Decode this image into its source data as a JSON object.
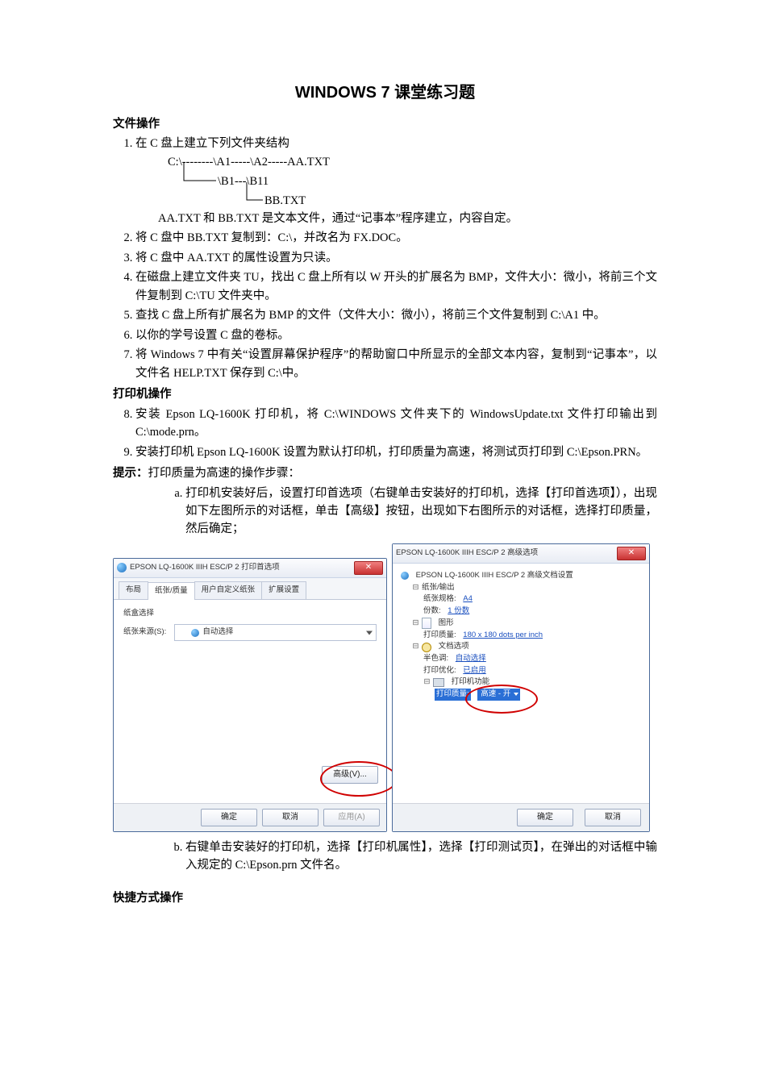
{
  "title": "WINDOWS 7 课堂练习题",
  "section1": "文件操作",
  "q1_intro": "在 C 盘上建立下列文件夹结构",
  "tree": {
    "l1": "C:\\--------\\A1-----\\A2-----AA.TXT",
    "l2": "\\B1---\\B11",
    "l3": "BB.TXT"
  },
  "q1_tail": "AA.TXT 和 BB.TXT 是文本文件，通过“记事本”程序建立，内容自定。",
  "q2": "将 C 盘中 BB.TXT 复制到：C:\\，并改名为 FX.DOC。",
  "q3": "将 C 盘中 AA.TXT 的属性设置为只读。",
  "q4": "在磁盘上建立文件夹 TU，找出 C 盘上所有以 W 开头的扩展名为 BMP，文件大小：微小，将前三个文件复制到 C:\\TU 文件夹中。",
  "q5": "查找 C 盘上所有扩展名为 BMP 的文件（文件大小：微小），将前三个文件复制到 C:\\A1 中。",
  "q6": "以你的学号设置 C 盘的卷标。",
  "q7": "将 Windows 7 中有关“设置屏幕保护程序”的帮助窗口中所显示的全部文本内容，复制到“记事本”，以文件名 HELP.TXT 保存到 C:\\中。",
  "section2": "打印机操作",
  "q8": "安装 Epson LQ-1600K 打印机，将 C:\\WINDOWS 文件夹下的 WindowsUpdate.txt 文件打印输出到 C:\\mode.prn。",
  "q9": "安装打印机 Epson LQ-1600K 设置为默认打印机，打印质量为高速，将测试页打印到 C:\\Epson.PRN。",
  "hint_label": "提示：",
  "hint_tail": "打印质量为高速的操作步骤：",
  "sub_a": "打印机安装好后，设置打印首选项（右键单击安装好的打印机，选择【打印首选项】），出现如下左图所示的对话框，单击【高级】按钮，出现如下右图所示的对话框，选择打印质量，然后确定；",
  "sub_b": "右键单击安装好的打印机，选择【打印机属性】，选择【打印测试页】，在弹出的对话框中输入规定的 C:\\Epson.prn 文件名。",
  "section3": "快捷方式操作",
  "dlg1": {
    "title": "EPSON LQ-1600K IIIH ESC/P 2 打印首选项",
    "tabs": [
      "布局",
      "纸张/质量",
      "用户自定义纸张",
      "扩展设置"
    ],
    "tray_section": "纸盒选择",
    "tray_label": "纸张来源(S):",
    "tray_value": "自动选择",
    "adv_btn": "高级(V)...",
    "ok": "确定",
    "cancel": "取消",
    "apply": "应用(A)"
  },
  "dlg2": {
    "title": "EPSON LQ-1600K IIIH ESC/P 2 高级选项",
    "root": "EPSON LQ-1600K IIIH ESC/P 2 高级文档设置",
    "grp_paper": "纸张/输出",
    "paper_size_k": "纸张规格:",
    "paper_size_v": "A4",
    "copies_k": "份数:",
    "copies_v": "1 份数",
    "grp_graphic": "图形",
    "prn_res_k": "打印质量:",
    "prn_res_v": "180 x 180 dots per inch",
    "grp_docopts": "文档选项",
    "half_k": "半色调:",
    "half_v": "自动选择",
    "opt_k": "打印优化:",
    "opt_v": "已启用",
    "grp_prnfn": "打印机功能",
    "speed_k": "打印质量:",
    "speed_v": "高速 - 开",
    "ok": "确定",
    "cancel": "取消"
  }
}
